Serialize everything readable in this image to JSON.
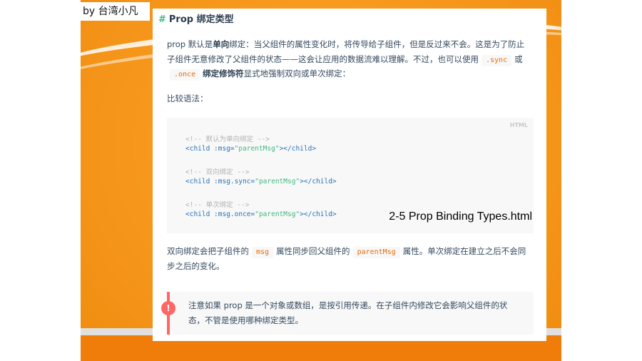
{
  "credit": "by 台湾小凡",
  "heading": {
    "hash": "#",
    "title": "Prop 绑定类型"
  },
  "para1": {
    "t1": "prop 默认是",
    "b1": "单向",
    "t2": "绑定：当父组件的属性变化时，将传导给子组件，但是反过来不会。这是为了防止子组件无意修改了父组件的状态——这会让应用的数据流难以理解。不过，也可以使用",
    "c1": ".sync",
    "t3": "或",
    "c2": ".once",
    "b2": "绑定修饰符",
    "t4": "显式地强制双向或单次绑定："
  },
  "para2": "比较语法：",
  "code": {
    "lang": "HTML",
    "lines": [
      {
        "comment": "<!-- 默认为单向绑定 -->"
      },
      {
        "open": "<child :msg=",
        "str": "\"parentMsg\"",
        "close": "></child>"
      },
      {
        "comment": "<!-- 双向绑定 -->"
      },
      {
        "open": "<child :msg.sync=",
        "str": "\"parentMsg\"",
        "close": "></child>"
      },
      {
        "comment": "<!-- 单次绑定 -->"
      },
      {
        "open": "<child :msg.once=",
        "str": "\"parentMsg\"",
        "close": "></child>"
      }
    ]
  },
  "caption": "2-5 Prop Binding Types.html",
  "para3": {
    "t1": "双向绑定会把子组件的",
    "c1": "msg",
    "t2": "属性同步回父组件的",
    "c2": "parentMsg",
    "t3": "属性。单次绑定在建立之后不会同步之后的变化。"
  },
  "tip": {
    "badge": "!",
    "text": "注意如果 prop 是一个对象或数组，是按引用传递。在子组件内修改它会影响父组件的状态，不管是使用哪种绑定类型。"
  }
}
